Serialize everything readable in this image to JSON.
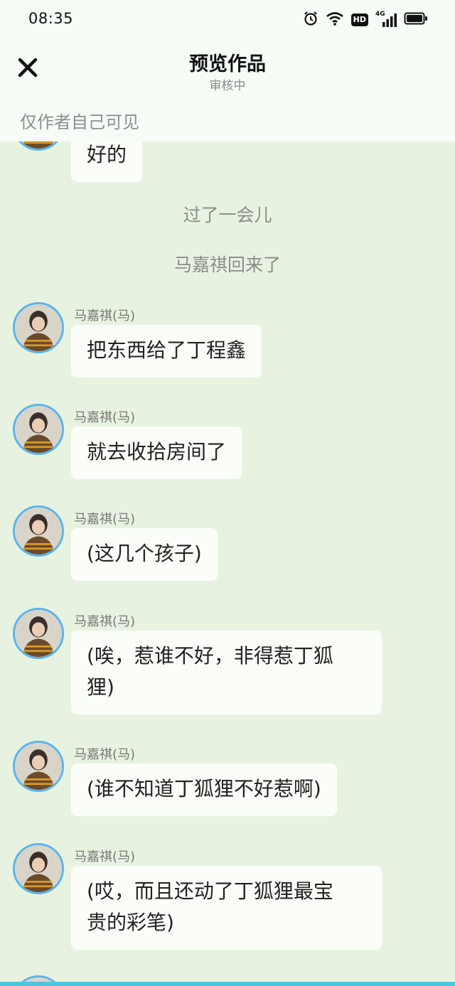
{
  "status": {
    "time": "08:35",
    "hd_badge": "HD",
    "network_label": "4G"
  },
  "header": {
    "title": "预览作品",
    "subtitle": "审核中",
    "visibility_note": "仅作者自己可见",
    "close_icon": "close-icon"
  },
  "chat": {
    "top_partial_message": "好的",
    "narrations": [
      "过了一会儿",
      "马嘉祺回来了"
    ],
    "messages": [
      {
        "sender": "马嘉祺(马)",
        "line1": "把东西给了丁程鑫",
        "line2": ""
      },
      {
        "sender": "马嘉祺(马)",
        "line1": "就去收拾房间了",
        "line2": ""
      },
      {
        "sender": "马嘉祺(马)",
        "line1": "(这几个孩子)",
        "line2": ""
      },
      {
        "sender": "马嘉祺(马)",
        "line1": "(唉，惹谁不好，非得惹丁狐",
        "line2": "狸)"
      },
      {
        "sender": "马嘉祺(马)",
        "line1": "(谁不知道丁狐狸不好惹啊)",
        "line2": ""
      },
      {
        "sender": "马嘉祺(马)",
        "line1": "(哎，而且还动了丁狐狸最宝",
        "line2": "贵的彩笔)"
      }
    ]
  },
  "colors": {
    "chat_background": "#e7f3e0",
    "header_background": "#f6fcf6",
    "bubble": "#fbfdf9",
    "avatar_ring": "#5ab4ec",
    "bottom_accent": "#4ec7dc"
  }
}
